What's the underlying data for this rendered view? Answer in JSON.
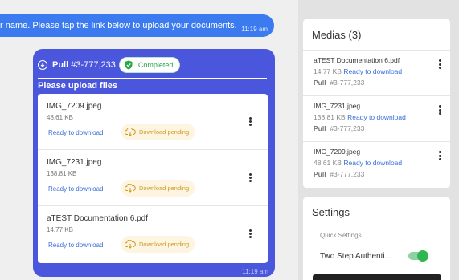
{
  "chat": {
    "top_message": {
      "text": "r name. Please tap the link below to upload your documents.",
      "time": "11:19 am"
    },
    "upload_card": {
      "pull_label": "Pull",
      "pull_number": "#3-777,233",
      "status": "Completed",
      "subtitle": "Please upload files",
      "time": "11:19 am",
      "files": [
        {
          "name": "IMG_7209.jpeg",
          "size": "48.61 KB",
          "ready": "Ready to download",
          "pending": "Download pending"
        },
        {
          "name": "IMG_7231.jpeg",
          "size": "138.81 KB",
          "ready": "Ready to download",
          "pending": "Download pending"
        },
        {
          "name": "aTEST Documentation 6.pdf",
          "size": "14.77 KB",
          "ready": "Ready to download",
          "pending": "Download pending"
        }
      ]
    }
  },
  "medias": {
    "title": "Medias (3)",
    "items": [
      {
        "name": "aTEST Documentation 6.pdf",
        "size": "14.77 KB",
        "ready": "Ready to download",
        "pull_label": "Pull",
        "pull_number": "#3-777,233"
      },
      {
        "name": "IMG_7231.jpeg",
        "size": "138.81 KB",
        "ready": "Ready to download",
        "pull_label": "Pull",
        "pull_number": "#3-777,233"
      },
      {
        "name": "IMG_7209.jpeg",
        "size": "48.61 KB",
        "ready": "Ready to download",
        "pull_label": "Pull",
        "pull_number": "#3-777,233"
      }
    ]
  },
  "settings": {
    "title": "Settings",
    "quick_label": "Quick Settings",
    "two_step_label": "Two Step Authenti...",
    "two_step_enabled": true
  },
  "colors": {
    "chat_blue": "#3b7bef",
    "card_indigo": "#4a56dc",
    "link_blue": "#3b6fd8",
    "success_green": "#28a745",
    "pending_amber": "#d09a1e"
  }
}
